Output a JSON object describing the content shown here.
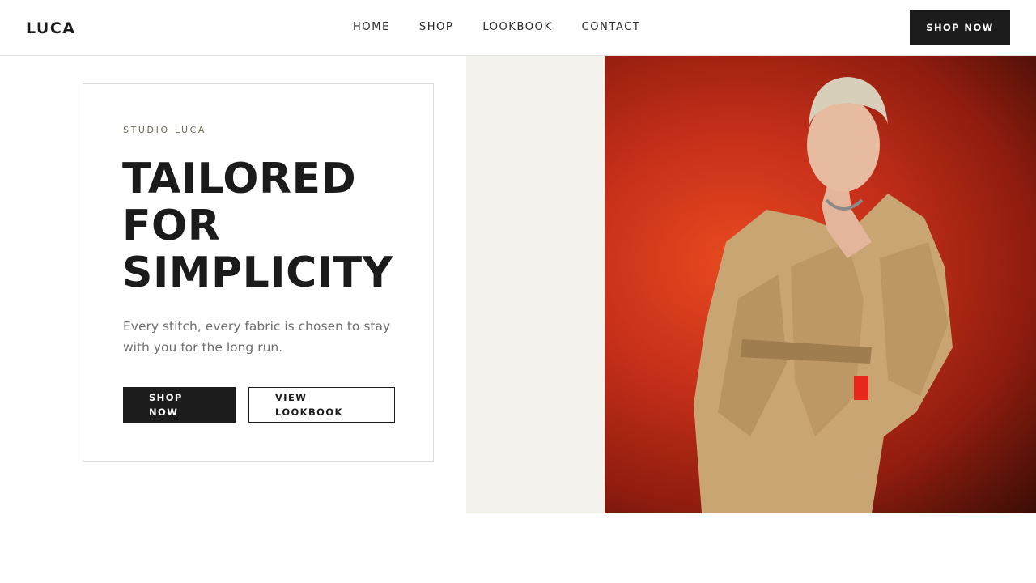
{
  "brand": {
    "logo": "LUCA"
  },
  "nav": {
    "items": [
      {
        "label": "HOME"
      },
      {
        "label": "SHOP"
      },
      {
        "label": "LOOKBOOK"
      },
      {
        "label": "CONTACT"
      }
    ],
    "cta_label": "SHOP NOW"
  },
  "hero": {
    "eyebrow": "STUDIO LUCA",
    "headline_lines": [
      "TAILORED",
      "FOR",
      "SIMPLICITY"
    ],
    "subtext": "Every stitch, every fabric is chosen to stay with you for the long run.",
    "primary_button": "SHOP NOW",
    "secondary_button": "VIEW LOOKBOOK",
    "image": "model in beige trench coat against red backdrop"
  },
  "colors": {
    "text": "#1b1b1b",
    "button_dark": "#1c1c1c",
    "eyebrow": "#6e6a4e",
    "beige_panel": "#f3f2ec",
    "photo_backdrop": "#d63a1c",
    "coat": "#c9a574"
  }
}
